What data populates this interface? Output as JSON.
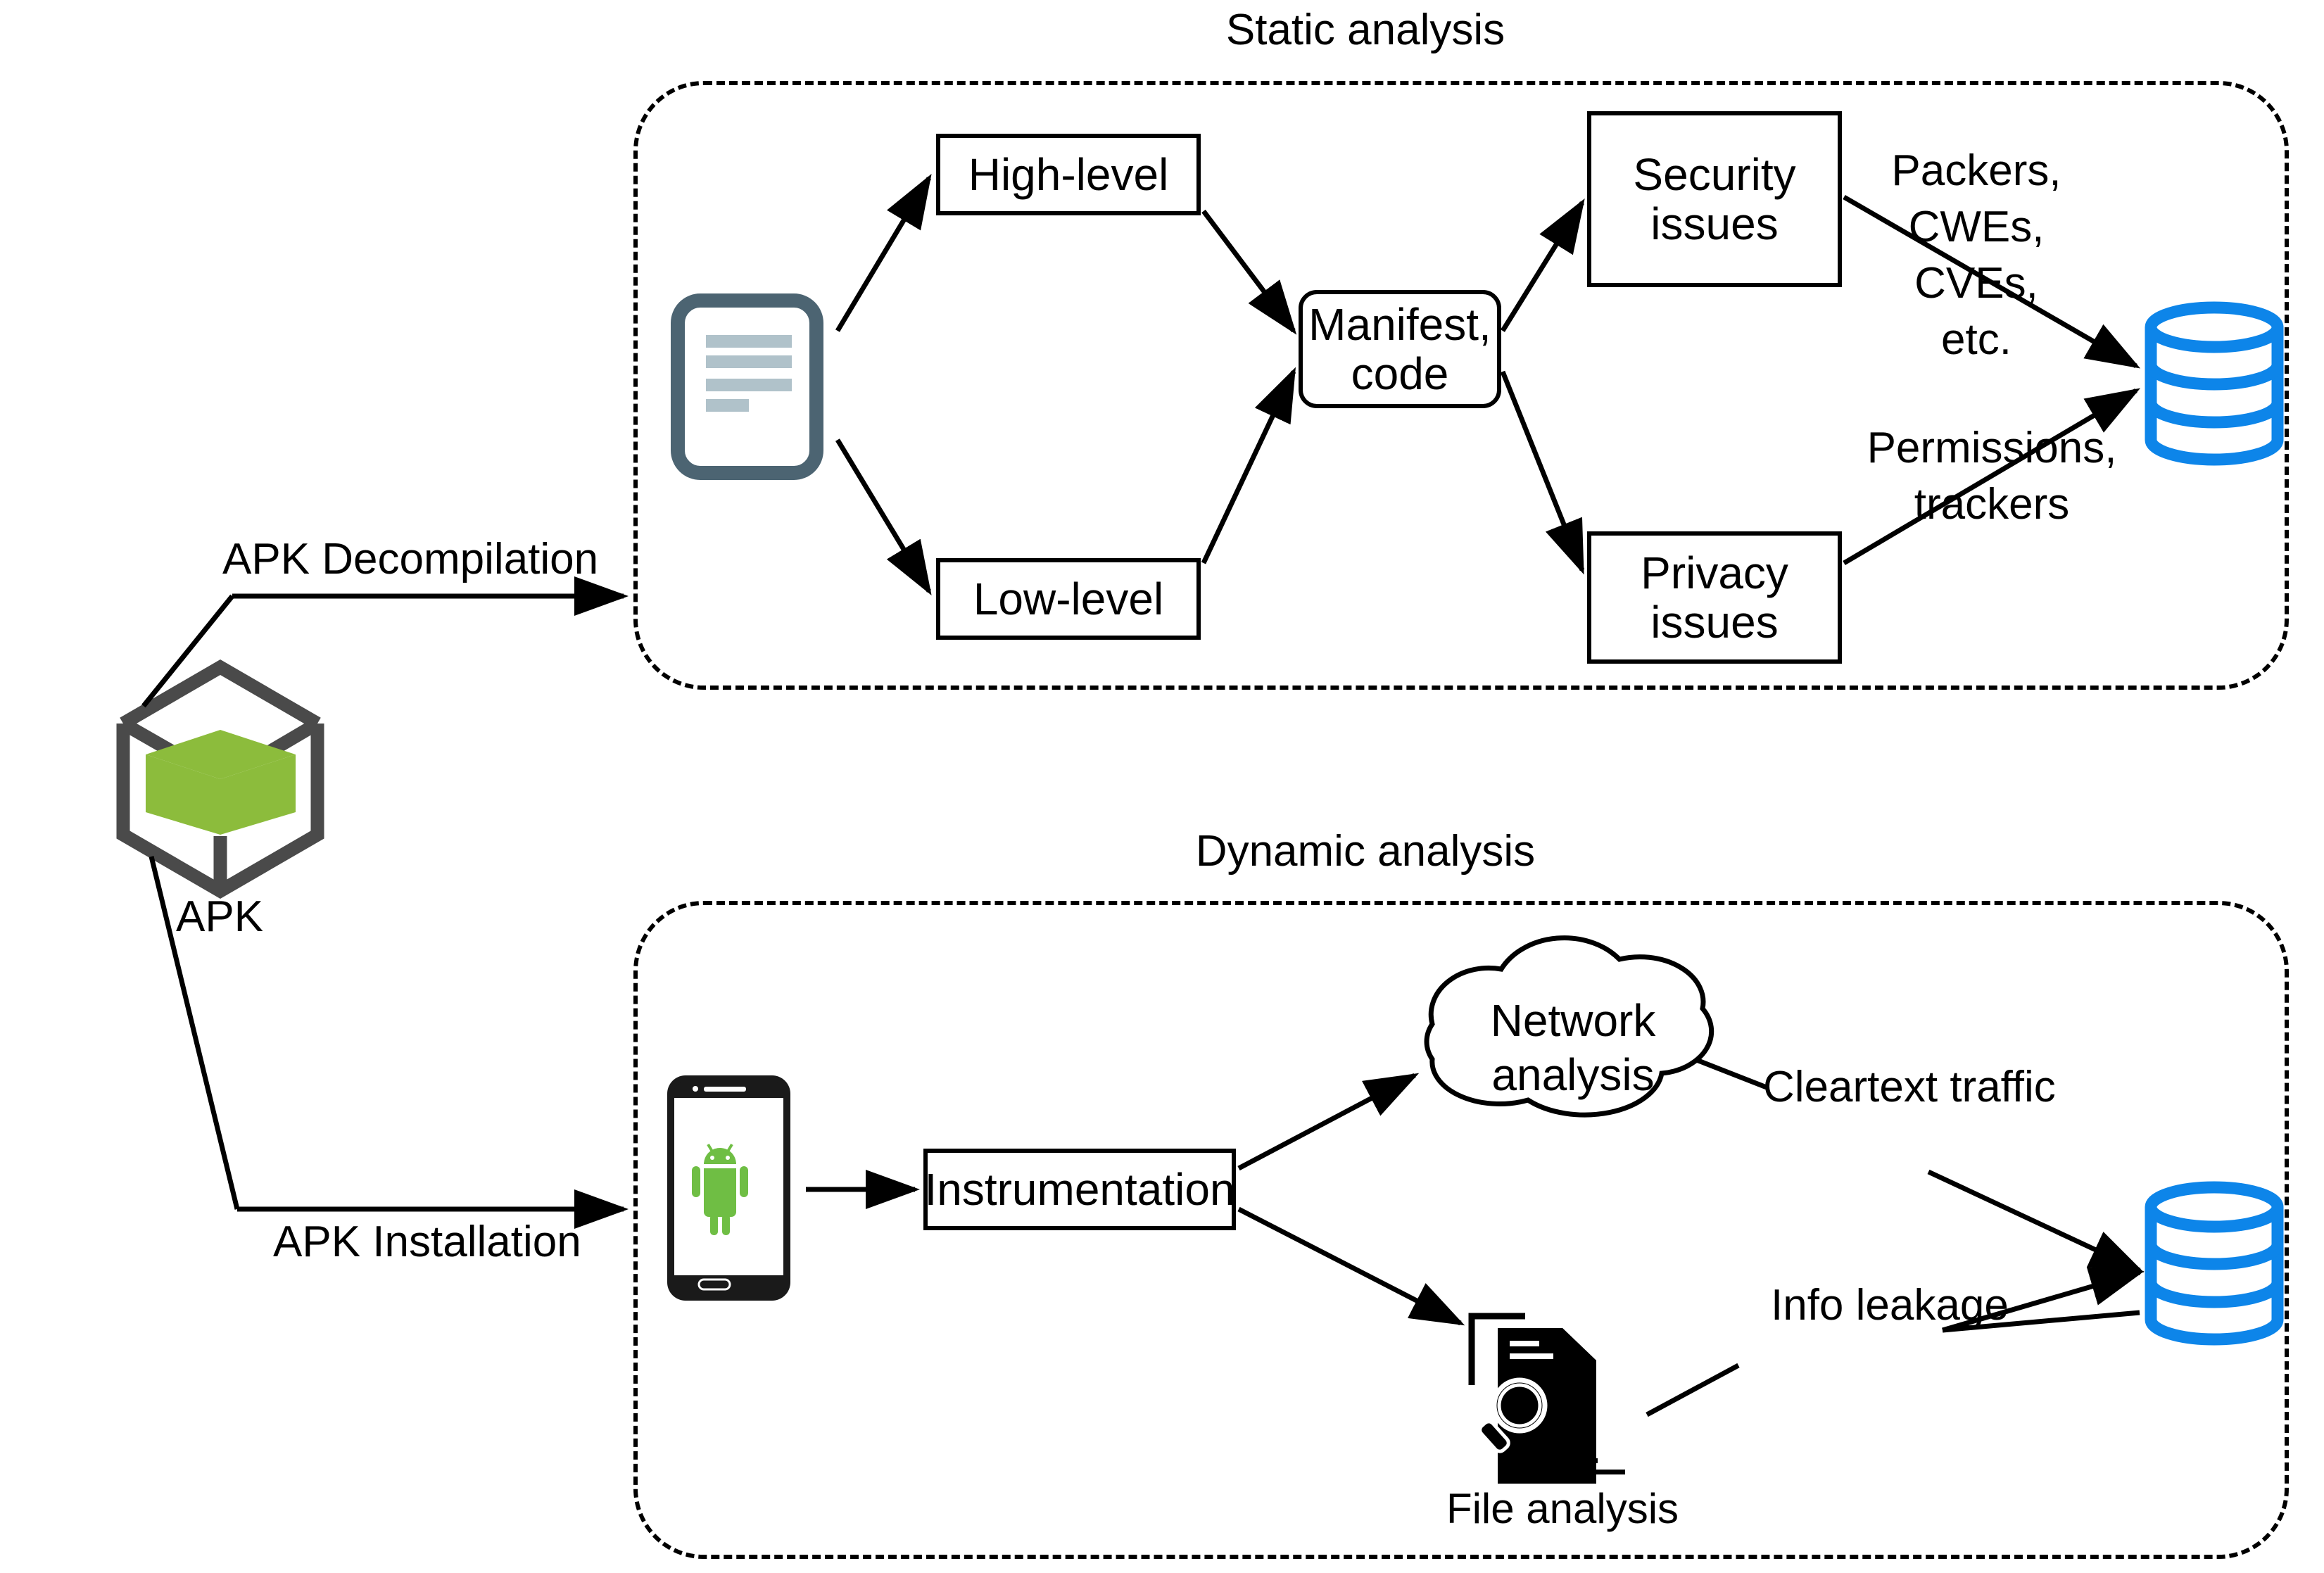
{
  "diagram": {
    "title_static": "Static analysis",
    "title_dynamic": "Dynamic analysis",
    "input": {
      "icon": "apk-cube-icon",
      "label": "APK",
      "cube_outline_color": "#4A4A4A",
      "cube_fill_color": "#8CBC3C"
    },
    "edges": {
      "apk_decompilation": "APK Decompilation",
      "apk_installation": "APK Installation",
      "packers_cwes": "Packers,\nCWEs,\nCVEs,\netc.",
      "packers_line1": "Packers,",
      "packers_line2": "CWEs,",
      "packers_line3": "CVEs,",
      "packers_line4": "etc.",
      "permissions_line1": "Permissions,",
      "permissions_line2": "trackers",
      "cleartext_traffic": "Cleartext traffic",
      "info_leakage": "Info leakage"
    },
    "static": {
      "doc_icon": "document-icon",
      "doc_border_color": "#4C6472",
      "doc_line_color": "#B0C2CA",
      "nodes": [
        {
          "id": "high-level",
          "label": "High-level"
        },
        {
          "id": "low-level",
          "label": "Low-level"
        },
        {
          "id": "manifest-code",
          "label": "Manifest,\ncode",
          "line1": "Manifest,",
          "line2": "code"
        },
        {
          "id": "security-issues",
          "label": "Security\nissues",
          "line1": "Security",
          "line2": "issues"
        },
        {
          "id": "privacy-issues",
          "label": "Privacy\nissues",
          "line1": "Privacy",
          "line2": "issues"
        }
      ],
      "database": {
        "icon": "database-icon",
        "color": "#0D85E9"
      }
    },
    "dynamic": {
      "phone_icon": "android-phone-icon",
      "phone_body_color": "#1A1A1A",
      "android_color": "#6FBE44",
      "nodes": [
        {
          "id": "instrumentation",
          "label": "Instrumentation"
        },
        {
          "id": "network-analysis",
          "label": "Network\nanalysis",
          "line1": "Network",
          "line2": "analysis"
        }
      ],
      "file_analysis": {
        "icon": "file-magnifier-icon",
        "label": "File analysis",
        "color": "#000000"
      },
      "database": {
        "icon": "database-icon",
        "color": "#0D85E9"
      }
    }
  }
}
